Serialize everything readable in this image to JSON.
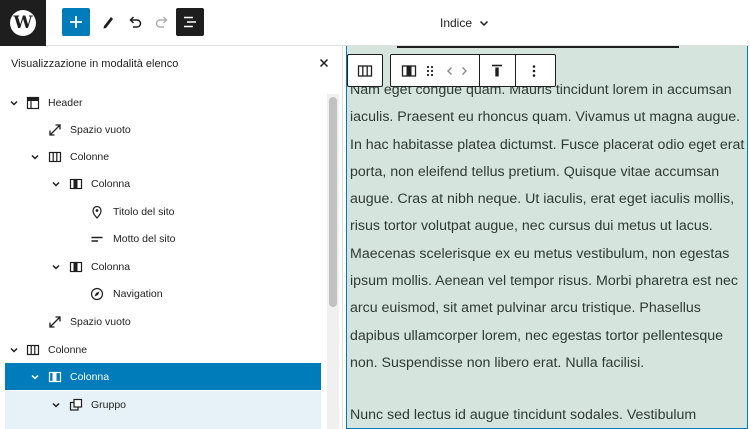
{
  "topbar": {
    "document_title": "Indice"
  },
  "list_view": {
    "title": "Visualizzazione in modalità elenco",
    "items": [
      {
        "label": "Header",
        "icon": "header-icon",
        "expanded": true
      },
      {
        "label": "Spazio vuoto",
        "icon": "spacer-icon"
      },
      {
        "label": "Colonne",
        "icon": "columns-icon",
        "expanded": true
      },
      {
        "label": "Colonna",
        "icon": "column-icon",
        "expanded": true
      },
      {
        "label": "Titolo del sito",
        "icon": "site-title-icon"
      },
      {
        "label": "Motto del sito",
        "icon": "tagline-icon"
      },
      {
        "label": "Colonna",
        "icon": "column-icon",
        "expanded": true
      },
      {
        "label": "Navigation",
        "icon": "navigation-icon"
      },
      {
        "label": "Spazio vuoto",
        "icon": "spacer-icon"
      },
      {
        "label": "Colonne",
        "icon": "columns-icon",
        "expanded": true
      },
      {
        "label": "Colonna",
        "icon": "column-icon",
        "expanded": true,
        "selected": true
      },
      {
        "label": "Gruppo",
        "icon": "group-icon",
        "expanded": true
      }
    ]
  },
  "canvas": {
    "paragraph_1": "Nam eget congue quam. Mauris tincidunt lorem in accumsan iaculis. Praesent eu rhoncus quam. Vivamus ut magna augue. In hac habitasse platea dictumst. Fusce placerat odio eget erat porta, non eleifend tellus pretium. Quisque vitae accumsan augue. Cras at nibh neque. Ut iaculis, erat eget iaculis mollis, risus tortor volutpat augue, nec cursus dui metus ut lacus. Maecenas scelerisque ex eu metus vestibulum, non egestas ipsum mollis. Aenean vel tempor risus. Morbi pharetra est nec arcu euismod, sit amet pulvinar arcu tristique. Phasellus dapibus ullamcorper lorem, nec egestas tortor pellentesque non. Suspendisse non libero erat. Nulla facilisi.",
    "paragraph_2": "Nunc sed lectus id augue tincidunt sodales. Vestibulum"
  },
  "colors": {
    "accent": "#007cba",
    "dark": "#1e1e1e",
    "canvas_bg": "#d5e5dd",
    "selected_child_bg": "#e6f2f8"
  }
}
